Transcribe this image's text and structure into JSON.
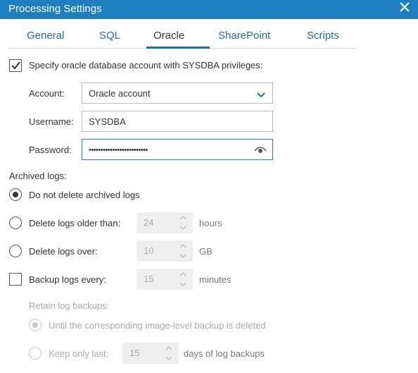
{
  "dialog": {
    "title": "Processing Settings",
    "close_icon": "close-icon"
  },
  "tabs": [
    {
      "label": "General"
    },
    {
      "label": "SQL"
    },
    {
      "label": "Oracle"
    },
    {
      "label": "SharePoint"
    },
    {
      "label": "Scripts"
    }
  ],
  "active_tab": "Oracle",
  "sysdba": {
    "checked": true,
    "label": "Specify oracle database account with SYSDBA privileges:"
  },
  "account": {
    "label": "Account:",
    "value": "Oracle account"
  },
  "username": {
    "label": "Username:",
    "value": "SYSDBA"
  },
  "password": {
    "label": "Password:",
    "value": "•••••••••••••••••••••••••"
  },
  "archived": {
    "heading": "Archived logs:",
    "options": [
      {
        "label": "Do not delete archived logs",
        "selected": true
      },
      {
        "label": "Delete logs older than:",
        "selected": false,
        "value": "24",
        "unit": "hours"
      },
      {
        "label": "Delete logs over:",
        "selected": false,
        "value": "10",
        "unit": "GB"
      }
    ]
  },
  "backup": {
    "checked": false,
    "label": "Backup logs every:",
    "value": "15",
    "unit": "minutes",
    "retain_heading": "Retain log backups:",
    "retain_options": [
      {
        "label": "Until the corresponding image-level backup is deleted",
        "selected": true
      },
      {
        "label": "Keep only last:",
        "selected": false,
        "value": "15",
        "unit": "days of log backups"
      }
    ]
  },
  "colors": {
    "titlebar": "#1d7fbf",
    "tab_link": "#1d6fa8"
  }
}
